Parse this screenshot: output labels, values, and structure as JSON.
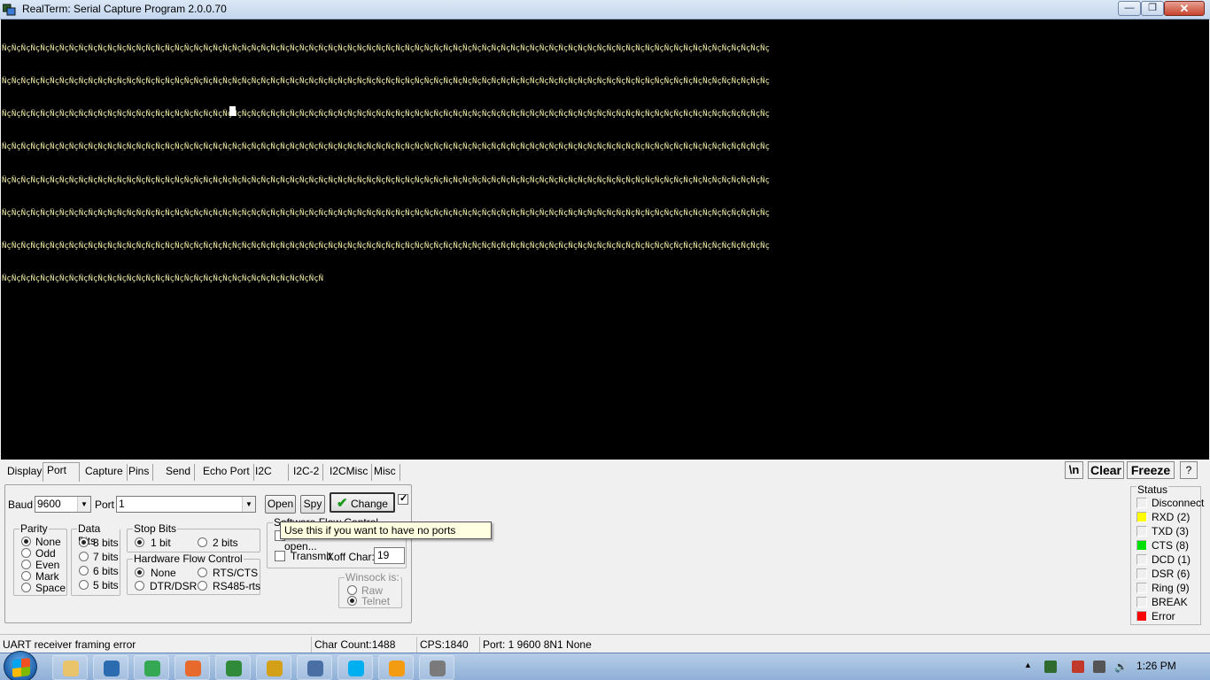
{
  "window": {
    "title": "RealTerm: Serial Capture Program 2.0.0.70",
    "min_glyph": "—",
    "max_glyph": "❐",
    "close_glyph": "✕"
  },
  "terminal": {
    "lines": [
      "ÑçÑçÑçÑçÑçÑçÑçÑçÑçÑçÑçÑçÑçÑçÑçÑçÑçÑçÑçÑçÑçÑçÑçÑçÑçÑçÑçÑçÑçÑçÑçÑçÑçÑçÑçÑçÑçÑçÑçÑçÑçÑçÑçÑçÑçÑçÑçÑçÑçÑçÑçÑçÑçÑçÑçÑçÑçÑçÑçÑçÑçÑçÑçÑçÑçÑçÑçÑçÑçÑçÑçÑçÑçÑçÑçÑçÑçÑçÑçÑç",
      "ÑçÑçÑçÑçÑçÑçÑçÑçÑçÑçÑçÑçÑçÑçÑçÑçÑçÑçÑçÑçÑçÑçÑçÑçÑçÑçÑçÑçÑçÑçÑçÑçÑçÑçÑçÑçÑçÑçÑçÑçÑçÑçÑçÑçÑçÑçÑçÑçÑçÑçÑçÑçÑçÑçÑçÑçÑçÑçÑçÑçÑçÑçÑçÑçÑçÑçÑçÑçÑçÑçÑçÑçÑçÑçÑçÑçÑçÑçÑçÑç",
      "ÑçÑçÑçÑçÑçÑçÑçÑçÑçÑçÑçÑçÑçÑçÑçÑçÑçÑçÑçÑçÑçÑçÑçÑçÑçÑçÑçÑçÑçÑçÑçÑçÑçÑçÑçÑçÑçÑçÑçÑçÑçÑçÑçÑçÑçÑçÑçÑçÑçÑçÑçÑçÑçÑçÑçÑçÑçÑçÑçÑçÑçÑçÑçÑçÑçÑçÑçÑçÑçÑçÑçÑçÑçÑçÑçÑçÑçÑçÑçÑç",
      "ÑçÑçÑçÑçÑçÑçÑçÑçÑçÑçÑçÑçÑçÑçÑçÑçÑçÑçÑçÑçÑçÑçÑçÑçÑçÑçÑçÑçÑçÑçÑçÑçÑçÑçÑçÑçÑçÑçÑçÑçÑçÑçÑçÑçÑçÑçÑçÑçÑçÑçÑçÑçÑçÑçÑçÑçÑçÑçÑçÑçÑçÑçÑçÑçÑçÑçÑçÑçÑçÑçÑçÑçÑçÑçÑçÑçÑçÑçÑçÑç",
      "ÑçÑçÑçÑçÑçÑçÑçÑçÑçÑçÑçÑçÑçÑçÑçÑçÑçÑçÑçÑçÑçÑçÑçÑçÑçÑçÑçÑçÑçÑçÑçÑçÑçÑçÑçÑçÑçÑçÑçÑçÑçÑçÑçÑçÑçÑçÑçÑçÑçÑçÑçÑçÑçÑçÑçÑçÑçÑçÑçÑçÑçÑçÑçÑçÑçÑçÑçÑçÑçÑçÑçÑçÑçÑçÑçÑçÑçÑçÑçÑç",
      "ÑçÑçÑçÑçÑçÑçÑçÑçÑçÑçÑçÑçÑçÑçÑçÑçÑçÑçÑçÑçÑçÑçÑçÑçÑçÑçÑçÑçÑçÑçÑçÑçÑçÑçÑçÑçÑçÑçÑçÑçÑçÑçÑçÑçÑçÑçÑçÑçÑçÑçÑçÑçÑçÑçÑçÑçÑçÑçÑçÑçÑçÑçÑçÑçÑçÑçÑçÑçÑçÑçÑçÑçÑçÑçÑçÑçÑçÑçÑçÑç",
      "ÑçÑçÑçÑçÑçÑçÑçÑçÑçÑçÑçÑçÑçÑçÑçÑçÑçÑçÑçÑçÑçÑçÑçÑçÑçÑçÑçÑçÑçÑçÑçÑçÑçÑçÑçÑçÑçÑçÑçÑçÑçÑçÑçÑçÑçÑçÑçÑçÑçÑçÑçÑçÑçÑçÑçÑçÑçÑçÑçÑçÑçÑçÑçÑçÑçÑçÑçÑçÑçÑçÑçÑçÑçÑçÑçÑçÑçÑçÑçÑç",
      "ÑçÑçÑçÑçÑçÑçÑçÑçÑçÑçÑçÑçÑçÑçÑçÑçÑçÑçÑçÑçÑçÑçÑçÑçÑçÑçÑçÑçÑçÑçÑçÑçÑçÑ"
    ]
  },
  "tabs": [
    {
      "label": "Display"
    },
    {
      "label": "Port"
    },
    {
      "label": "Capture"
    },
    {
      "label": "Pins"
    },
    {
      "label": "Send"
    },
    {
      "label": "Echo Port"
    },
    {
      "label": "I2C"
    },
    {
      "label": "I2C-2"
    },
    {
      "label": "I2CMisc"
    },
    {
      "label": "Misc"
    }
  ],
  "top_buttons": {
    "newline": "\\n",
    "clear": "Clear",
    "freeze": "Freeze",
    "help": "?"
  },
  "port": {
    "baud_label": "Baud",
    "baud_value": "9600",
    "port_label": "Port",
    "port_value": "1",
    "open_label": "Open",
    "spy_label": "Spy",
    "change_label": "Change",
    "parity": {
      "title": "Parity",
      "options": [
        "None",
        "Odd",
        "Even",
        "Mark",
        "Space"
      ],
      "selected": "None"
    },
    "data_bits": {
      "title": "Data Bits",
      "options": [
        "8 bits",
        "7 bits",
        "6 bits",
        "5 bits"
      ],
      "selected": "8 bits"
    },
    "stop_bits": {
      "title": "Stop Bits",
      "options": [
        "1 bit",
        "2 bits"
      ],
      "selected": "1 bit"
    },
    "hw_flow": {
      "title": "Hardware Flow Control",
      "options": [
        "None",
        "RTS/CTS",
        "DTR/DSR",
        "RS485-rts"
      ],
      "selected": "None"
    },
    "sw_flow": {
      "title": "Software Flow Control",
      "transmit_label": "Transmit",
      "xoff_label": "Xoff Char:",
      "xoff_value": "19"
    },
    "winsock": {
      "title": "Winsock is:",
      "options": [
        "Raw",
        "Telnet"
      ],
      "selected": "Telnet"
    }
  },
  "tooltip": "Use this if you want to have no ports open...",
  "status": {
    "title": "Status",
    "items": [
      {
        "name": "Disconnect",
        "color": "#f0f0f0"
      },
      {
        "name": "RXD (2)",
        "color": "#ffff00"
      },
      {
        "name": "TXD (3)",
        "color": "#f0f0f0"
      },
      {
        "name": "CTS (8)",
        "color": "#00e000"
      },
      {
        "name": "DCD (1)",
        "color": "#f0f0f0"
      },
      {
        "name": "DSR (6)",
        "color": "#f0f0f0"
      },
      {
        "name": "Ring (9)",
        "color": "#f0f0f0"
      },
      {
        "name": "BREAK",
        "color": "#f0f0f0"
      },
      {
        "name": "Error",
        "color": "#ff0000"
      }
    ]
  },
  "statusbar": {
    "message": "UART receiver framing error",
    "char_count": "Char Count:1488",
    "cps": "CPS:1840",
    "port_info": "Port: 1 9600 8N1 None"
  },
  "taskbar": {
    "clock": "1:26 PM",
    "apps": [
      {
        "name": "explorer",
        "color": "#e9c46a"
      },
      {
        "name": "media-player",
        "color": "#2b6cb0"
      },
      {
        "name": "chrome",
        "color": "#34a853"
      },
      {
        "name": "firefox",
        "color": "#e8692c"
      },
      {
        "name": "network-tool",
        "color": "#2f8a3a"
      },
      {
        "name": "usb-tool",
        "color": "#d4a017"
      },
      {
        "name": "calculator",
        "color": "#4a6fa5"
      },
      {
        "name": "skype",
        "color": "#00aff0"
      },
      {
        "name": "g-app",
        "color": "#f39c12"
      },
      {
        "name": "tools",
        "color": "#7a7a7a"
      }
    ]
  }
}
